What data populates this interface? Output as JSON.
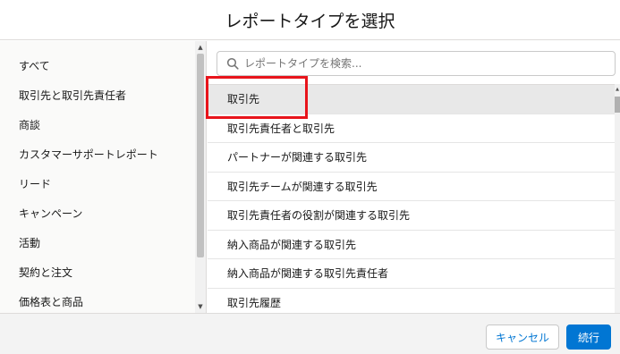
{
  "modal": {
    "title": "レポートタイプを選択"
  },
  "categories": [
    {
      "label": "すべて"
    },
    {
      "label": "取引先と取引先責任者"
    },
    {
      "label": "商談"
    },
    {
      "label": "カスタマーサポートレポート"
    },
    {
      "label": "リード"
    },
    {
      "label": "キャンペーン"
    },
    {
      "label": "活動"
    },
    {
      "label": "契約と注文"
    },
    {
      "label": "価格表と商品"
    }
  ],
  "search": {
    "placeholder": "レポートタイプを検索...",
    "value": "",
    "icon": "search-icon"
  },
  "report_types": [
    {
      "label": "取引先",
      "selected": true
    },
    {
      "label": "取引先責任者と取引先",
      "selected": false
    },
    {
      "label": "パートナーが関連する取引先",
      "selected": false
    },
    {
      "label": "取引先チームが関連する取引先",
      "selected": false
    },
    {
      "label": "取引先責任者の役割が関連する取引先",
      "selected": false
    },
    {
      "label": "納入商品が関連する取引先",
      "selected": false
    },
    {
      "label": "納入商品が関連する取引先責任者",
      "selected": false
    },
    {
      "label": "取引先履歴",
      "selected": false
    }
  ],
  "footer": {
    "cancel_label": "キャンセル",
    "continue_label": "続行"
  },
  "colors": {
    "brand": "#0176d3",
    "highlight": "#e8141b"
  }
}
